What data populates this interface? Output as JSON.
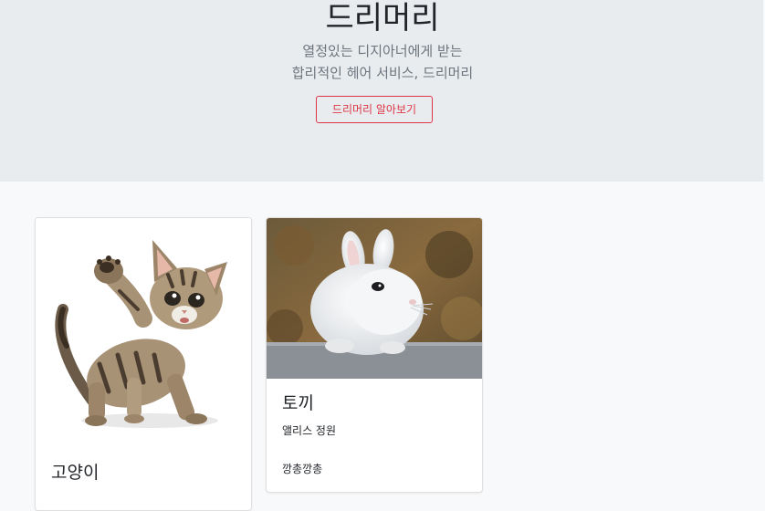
{
  "hero": {
    "title": "드리머리",
    "subtitle_line1": "열정있는 디지아너에게 받는",
    "subtitle_line2": "합리적인 헤어 서비스, 드리머리",
    "button_label": "드리머리 알아보기"
  },
  "cards": [
    {
      "title": "고양이",
      "subtitle": "",
      "text": "",
      "image": "kitten-photo"
    },
    {
      "title": "토끼",
      "subtitle": "앨리스 정원",
      "text": "깡총깡총",
      "image": "rabbit-photo"
    }
  ],
  "colors": {
    "hero_bg": "#e9ecef",
    "page_bg": "#f8f9fa",
    "accent": "#dc3545",
    "muted": "#6c757d"
  }
}
